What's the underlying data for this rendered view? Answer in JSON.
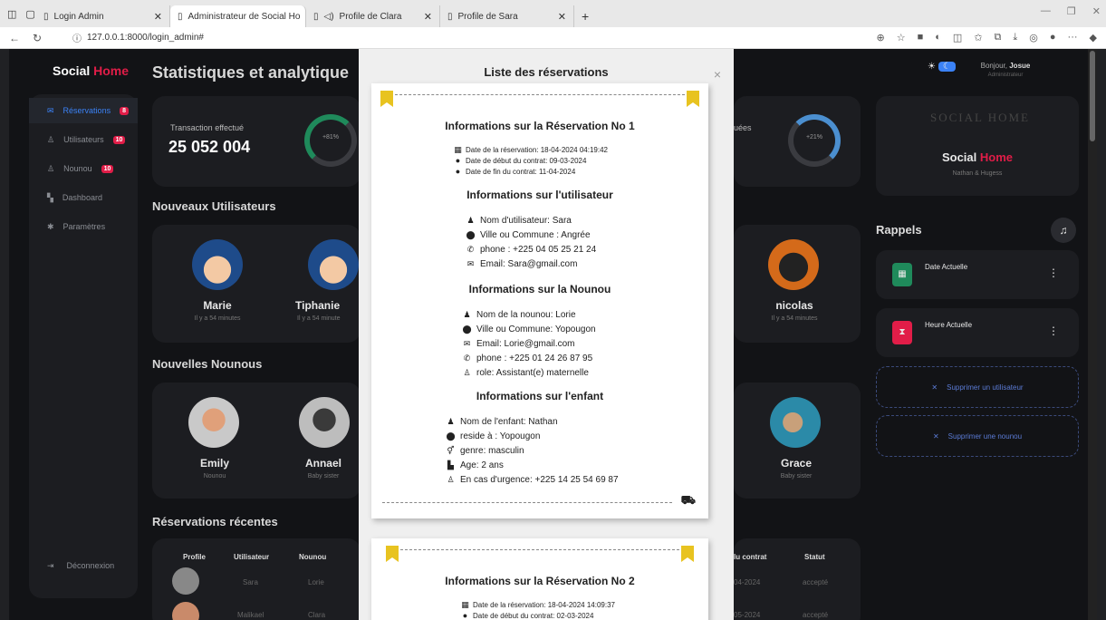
{
  "browser": {
    "tabs": [
      {
        "label": "Login Admin"
      },
      {
        "label": "Administrateur de Social Ho"
      },
      {
        "label": "Profile de Clara"
      },
      {
        "label": "Profile de Sara"
      }
    ],
    "url": "127.0.0.1:8000/login_admin#"
  },
  "sidebar": {
    "brand_a": "Social",
    "brand_b": "Home",
    "items": [
      {
        "label": "Réservations",
        "badge": "8"
      },
      {
        "label": "Utilisateurs",
        "badge": "10"
      },
      {
        "label": "Nounou",
        "badge": "10"
      },
      {
        "label": "Dashboard"
      },
      {
        "label": "Paramètres"
      }
    ],
    "logout": "Déconnexion"
  },
  "main": {
    "title": "Statistiques et analytique",
    "stat1": {
      "label": "Transaction effectué",
      "value": "25 052 004",
      "pct": "+81%"
    },
    "stat2": {
      "label": "uées",
      "pct": "+21%"
    },
    "new_users_title": "Nouveaux Utilisateurs",
    "users": [
      {
        "name": "Marie",
        "sub": "Il y a 54 minutes"
      },
      {
        "name": "Tiphanie",
        "sub": "Il y a 54 minute"
      },
      {
        "name": "nicolas",
        "sub": "Il y a 54 minutes"
      }
    ],
    "new_nannies_title": "Nouvelles Nounous",
    "nannies": [
      {
        "name": "Emily",
        "sub": "Nounou"
      },
      {
        "name": "Annael",
        "sub": "Baby sister"
      },
      {
        "name": "Grace",
        "sub": "Baby sister"
      }
    ],
    "recent_title": "Réservations récentes",
    "table_headers": {
      "profile": "Profile",
      "user": "Utilisateur",
      "nanny": "Nounou",
      "contract": "lu contrat",
      "status": "Statut"
    },
    "rows": [
      {
        "user": "Sara",
        "nanny": "Lorie",
        "contract": "04-2024",
        "status": "accepté"
      },
      {
        "user": "Malikael",
        "nanny": "Clara",
        "contract": "05-2024",
        "status": "accepté"
      }
    ]
  },
  "right": {
    "greeting": "Bonjour,",
    "username": "Josue",
    "role": "Administrateur",
    "brand_a": "Social",
    "brand_b": "Home",
    "owners": "Nathan & Hugess",
    "logo_text": "SOCIAL HOME",
    "reminders_title": "Rappels",
    "reminder1": "Date Actuelle",
    "reminder2": "Heure Actuelle",
    "delete_user": "Supprimer un utilisateur",
    "delete_nanny": "Supprimer une nounou"
  },
  "modal": {
    "title": "Liste des réservations",
    "close": "×",
    "res1": {
      "heading": "Informations sur la Réservation No 1",
      "date_res": "Date de la réservation: 18-04-2024 04:19:42",
      "date_start": "Date de début du contrat: 09-03-2024",
      "date_end": "Date de fin du contrat: 11-04-2024",
      "user_heading": "Informations sur l'utilisateur",
      "user_name": "Nom d'utilisateur: Sara",
      "user_city": "Ville ou Commune : Angrée",
      "user_phone": "phone : +225 04 05 25 21 24",
      "user_email": "Email: Sara@gmail.com",
      "nanny_heading": "Informations sur la Nounou",
      "nanny_name": "Nom de la nounou: Lorie",
      "nanny_city": "Ville ou Commune: Yopougon",
      "nanny_email": "Email: Lorie@gmail.com",
      "nanny_phone": "phone : +225 01 24 26 87 95",
      "nanny_role": "role: Assistant(e) maternelle",
      "child_heading": "Informations sur l'enfant",
      "child_name": "Nom de l'enfant: Nathan",
      "child_city": "reside à : Yopougon",
      "child_gender": "genre: masculin",
      "child_age": "Age: 2 ans",
      "child_emergency": "En cas d'urgence: +225 14 25 54 69 87"
    },
    "res2": {
      "heading": "Informations sur la Réservation No 2",
      "date_res": "Date de la réservation: 18-04-2024 14:09:37",
      "date_start": "Date de début du contrat: 02-03-2024"
    }
  }
}
